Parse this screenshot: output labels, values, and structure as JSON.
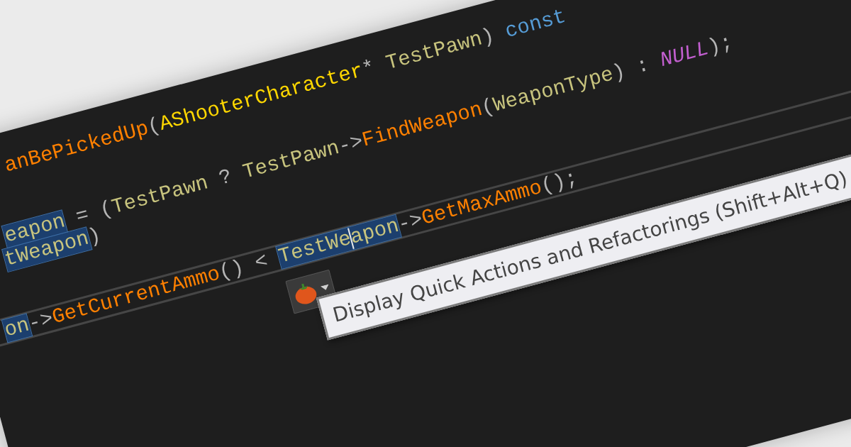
{
  "editor": {
    "lines": [
      {
        "kind": "code",
        "tokens": [
          {
            "text": "anBePickedUp",
            "kind": "function",
            "highlighted": false
          },
          {
            "text": "(",
            "kind": "punct",
            "highlighted": false
          },
          {
            "text": "AShooterCharacter",
            "kind": "type",
            "highlighted": false
          },
          {
            "text": "* ",
            "kind": "punct",
            "highlighted": false
          },
          {
            "text": "TestPawn",
            "kind": "variable",
            "highlighted": false
          },
          {
            "text": ") ",
            "kind": "punct",
            "highlighted": false
          },
          {
            "text": "const",
            "kind": "keyword",
            "highlighted": false
          }
        ]
      },
      {
        "kind": "blank"
      },
      {
        "kind": "blank"
      },
      {
        "kind": "code",
        "tokens": [
          {
            "text": "eapon",
            "kind": "variable",
            "highlighted": true
          },
          {
            "text": " = (",
            "kind": "punct",
            "highlighted": false
          },
          {
            "text": "TestPawn",
            "kind": "variable",
            "highlighted": false
          },
          {
            "text": " ? ",
            "kind": "punct",
            "highlighted": false
          },
          {
            "text": "TestPawn",
            "kind": "variable",
            "highlighted": false
          },
          {
            "text": "->",
            "kind": "punct",
            "highlighted": false
          },
          {
            "text": "FindWeapon",
            "kind": "function",
            "highlighted": false
          },
          {
            "text": "(",
            "kind": "punct",
            "highlighted": false
          },
          {
            "text": "WeaponType",
            "kind": "variable",
            "highlighted": false
          },
          {
            "text": ") : ",
            "kind": "punct",
            "highlighted": false
          },
          {
            "text": "NULL",
            "kind": "macro",
            "highlighted": false
          },
          {
            "text": ");",
            "kind": "punct",
            "highlighted": false
          }
        ]
      },
      {
        "kind": "code",
        "tokens": [
          {
            "text": "tWeapon",
            "kind": "variable",
            "highlighted": true
          },
          {
            "text": ")",
            "kind": "punct",
            "highlighted": false
          }
        ]
      },
      {
        "kind": "blank"
      },
      {
        "kind": "blank"
      }
    ],
    "current_line": {
      "tokens": [
        {
          "text": "on",
          "kind": "variable",
          "highlighted": true
        },
        {
          "text": "->",
          "kind": "punct",
          "highlighted": false
        },
        {
          "text": "GetCurrentAmmo",
          "kind": "function",
          "highlighted": false
        },
        {
          "text": "() < ",
          "kind": "punct",
          "highlighted": false
        },
        {
          "text": "TestWe",
          "kind": "variable",
          "highlighted": true
        },
        {
          "kind": "caret"
        },
        {
          "text": "apon",
          "kind": "variable",
          "highlighted": true
        },
        {
          "text": "->",
          "kind": "punct",
          "highlighted": false
        },
        {
          "text": "GetMaxAmmo",
          "kind": "function",
          "highlighted": false
        },
        {
          "text": "();",
          "kind": "punct",
          "highlighted": false
        }
      ]
    }
  },
  "quick_actions": {
    "tooltip": "Display Quick Actions and Refactorings (Shift+Alt+Q)"
  }
}
